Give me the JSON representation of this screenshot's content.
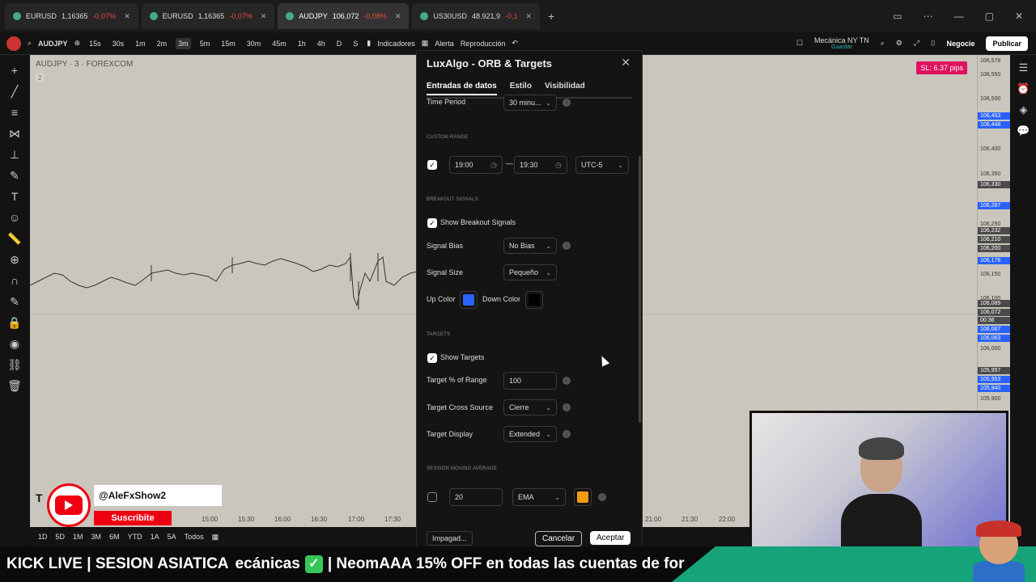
{
  "tabs": [
    {
      "symbol": "EURUSD",
      "price": "1,16365",
      "change": "-0,07%"
    },
    {
      "symbol": "EURUSD",
      "price": "1,16365",
      "change": "-0,07%"
    },
    {
      "symbol": "AUDJPY",
      "price": "106,072",
      "change": "-0,08%"
    },
    {
      "symbol": "US30USD",
      "price": "48.921,9",
      "change": "-0,1"
    }
  ],
  "toolbar": {
    "symbol": "AUDJPY",
    "timeframes": [
      "15s",
      "30s",
      "1m",
      "2m",
      "3m",
      "5m",
      "15m",
      "30m",
      "45m",
      "1h",
      "4h",
      "D",
      "S"
    ],
    "active_timeframe": "3m",
    "indicators": "Indicadores",
    "alerta": "Alerta",
    "reproduccion": "Reproducción",
    "mecanica": "Mecánica NY TN",
    "guardar": "Guardar",
    "negocie": "Negocie",
    "publicar": "Publicar"
  },
  "chart": {
    "title": "AUDJPY · 3 · FOREXCOM",
    "sub": "2",
    "sl_badge": "SL: 6.37 pips",
    "time_labels": [
      "15:00",
      "15:30",
      "16:00",
      "16:30",
      "17:00",
      "17:30",
      "21:00",
      "21:30",
      "22:00"
    ]
  },
  "prices": {
    "labels": [
      "106,578",
      "106,550",
      "106,500",
      "106,400",
      "106,350",
      "106,250",
      "106,150",
      "106,100",
      "106,000",
      "105,900"
    ],
    "tags": [
      {
        "v": "106,453",
        "c": "blue"
      },
      {
        "v": "106,448",
        "c": "blue"
      },
      {
        "v": "106,330",
        "c": "gray"
      },
      {
        "v": "106,287",
        "c": "blue"
      },
      {
        "v": "106,232",
        "c": "gray"
      },
      {
        "v": "106,210",
        "c": "gray"
      },
      {
        "v": "106,200",
        "c": "gray"
      },
      {
        "v": "106,176",
        "c": "blue"
      },
      {
        "v": "106,089",
        "c": "gray"
      },
      {
        "v": "106,072",
        "c": "gray"
      },
      {
        "v": "00:36",
        "c": "gray"
      },
      {
        "v": "106,067",
        "c": "blue"
      },
      {
        "v": "106,063",
        "c": "blue"
      },
      {
        "v": "105,957",
        "c": "gray"
      },
      {
        "v": "105,953",
        "c": "blue"
      },
      {
        "v": "105,940",
        "c": "blue"
      }
    ]
  },
  "ranges": [
    "1D",
    "5D",
    "1M",
    "3M",
    "6M",
    "YTD",
    "1A",
    "5A",
    "Todos"
  ],
  "dialog": {
    "title": "LuxAlgo - ORB & Targets",
    "tabs": [
      "Entradas de datos",
      "Estilo",
      "Visibilidad"
    ],
    "time_period_label": "Time Period",
    "time_period_value": "30 minu...",
    "custom_range_section": "CUSTOM RANGE",
    "start_time": "19:00",
    "range_dash": "—",
    "end_time": "19:30",
    "timezone": "UTC-5",
    "breakout_section": "BREAKOUT SIGNALS",
    "show_breakout_label": "Show Breakout Signals",
    "signal_bias_label": "Signal Bias",
    "signal_bias_value": "No Bias",
    "signal_size_label": "Signal Size",
    "signal_size_value": "Pequeño",
    "up_color_label": "Up Color",
    "down_color_label": "Down Color",
    "up_color": "#2962ff",
    "down_color": "#000000",
    "targets_section": "TARGETS",
    "show_targets_label": "Show Targets",
    "target_pct_label": "Target % of Range",
    "target_pct_value": "100",
    "cross_source_label": "Target Cross Source",
    "cross_source_value": "Cierre",
    "display_label": "Target Display",
    "display_value": "Extended",
    "sma_section": "SESSION MOVING AVERAGE",
    "sma_length": "20",
    "sma_type": "EMA",
    "sma_color": "#f29c0f",
    "template": "Impagad...",
    "cancel": "Cancelar",
    "accept": "Aceptar"
  },
  "overlay": {
    "yt_handle": "@AleFxShow2",
    "yt_subscribe": "Suscribite",
    "yt_t": "T",
    "ticker_lead": "KICK LIVE | SESION ASIATICA",
    "ticker_mid": "ecánicas",
    "ticker_check": "✓",
    "ticker_tail": "| NeomAAA 15% OFF en todas las cuentas de for"
  }
}
